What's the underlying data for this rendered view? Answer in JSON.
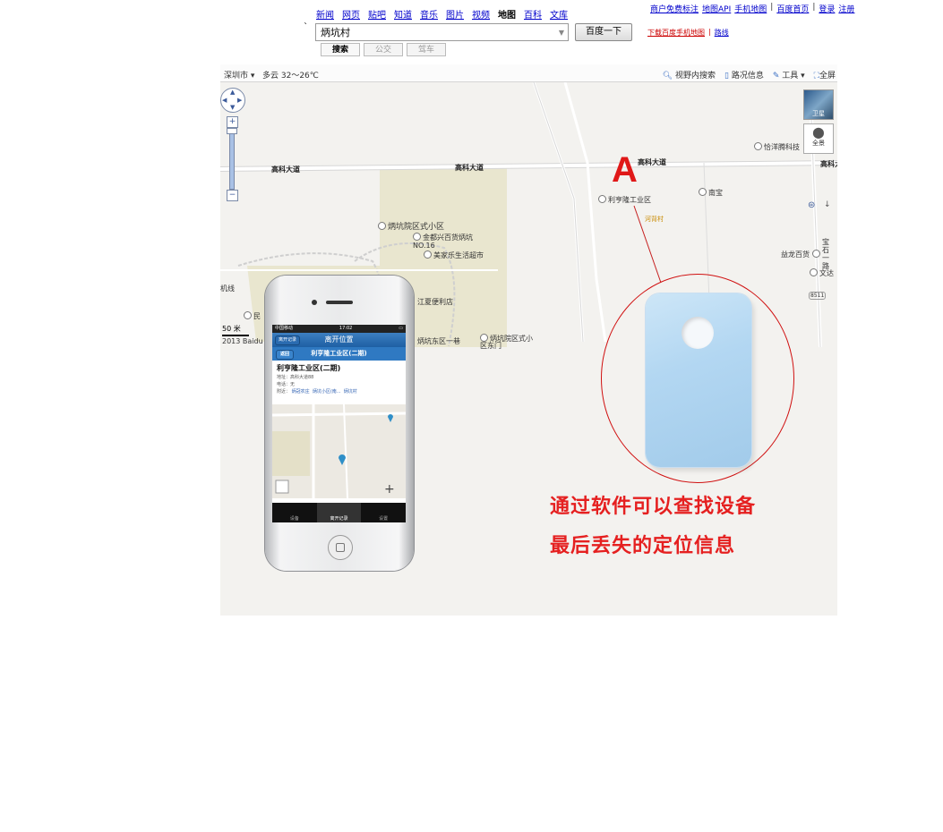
{
  "nav": {
    "items": [
      "新闻",
      "网页",
      "贴吧",
      "知道",
      "音乐",
      "图片",
      "视频",
      "地图",
      "百科",
      "文库"
    ],
    "current": "地图"
  },
  "top_links": [
    "商户免费标注",
    "地图API",
    "手机地图",
    "百度首页",
    "登录",
    "注册"
  ],
  "search": {
    "value": "炳坑村",
    "button": "百度一下",
    "tabs": [
      "搜索",
      "公交",
      "驾车"
    ]
  },
  "download_links": [
    "下载百度手机地图",
    "路线"
  ],
  "toolbar": {
    "city": "深圳市",
    "weather": "多云 32～26℃",
    "tools": [
      "视野内搜索",
      "路况信息",
      "工具",
      "全屏"
    ]
  },
  "map": {
    "road_labels": [
      "高科大道",
      "高科大道",
      "高科大道",
      "高科大"
    ],
    "pois": [
      "炳坑院区式小区",
      "金都兴百货炳坑NO.16",
      "美家乐生活超市",
      "江夏便利店",
      "利亨隆工业区",
      "南宝",
      "恰洋腾科技",
      "益龙百货",
      "文达",
      "民",
      "炳坑东区一巷",
      "炳坑院区式小区东门",
      "河背村"
    ],
    "vertical_label": "宝石一路",
    "sat_label": "卫星",
    "pano_label": "全景",
    "marker": "A",
    "scale": "50 米",
    "copyright": "2013 Baidu - G",
    "left_edge_label": "机线",
    "small_badge": "8511"
  },
  "phone": {
    "status_carrier": "中国移动",
    "status_time": "17:02",
    "title": "离开位置",
    "title_left": "离开记录",
    "subtitle": "利亨隆工业区(二期)",
    "back": "返回",
    "place_name": "利亨隆工业区(二期)",
    "address": "地址：高科大道88",
    "phone_line": "电话：无",
    "nearby_label": "附近：",
    "nearby_links": [
      "炳冠农庄",
      "炳坑小区(南...",
      "炳坑村"
    ],
    "tabs": [
      "设备",
      "离开记录",
      "设置"
    ]
  },
  "captions": [
    "通过软件可以查找设备",
    "最后丢失的定位信息"
  ]
}
